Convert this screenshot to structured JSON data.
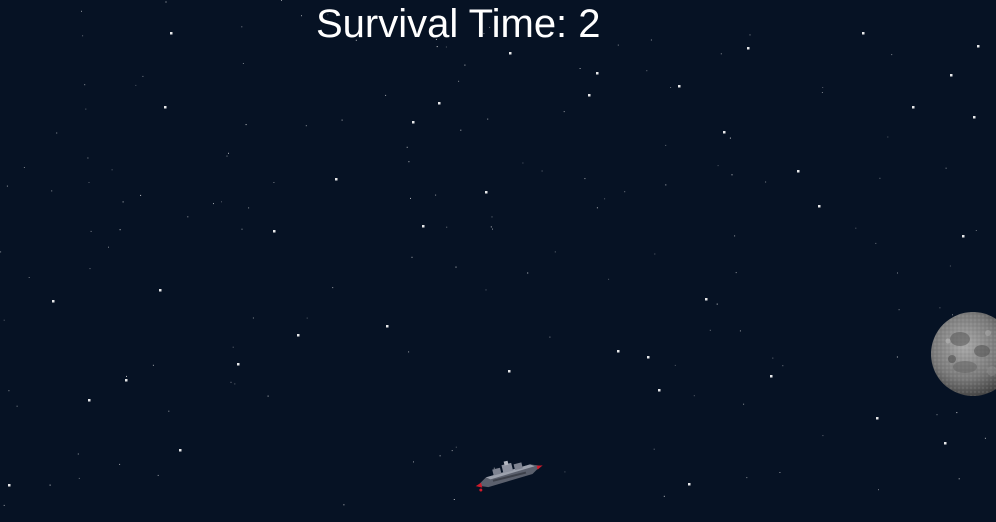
{
  "hud": {
    "survival_label": "Survival Time: 2"
  },
  "colors": {
    "space_background": "#061224",
    "star": "#ffffff",
    "hud_text": "#ffffff",
    "ship_hull": "#8a8f9c",
    "ship_accent": "#d11a2a",
    "moon": "#8a8a8a"
  },
  "icons": {
    "player": "spaceship-icon",
    "obstacle": "moon-asteroid-icon"
  }
}
